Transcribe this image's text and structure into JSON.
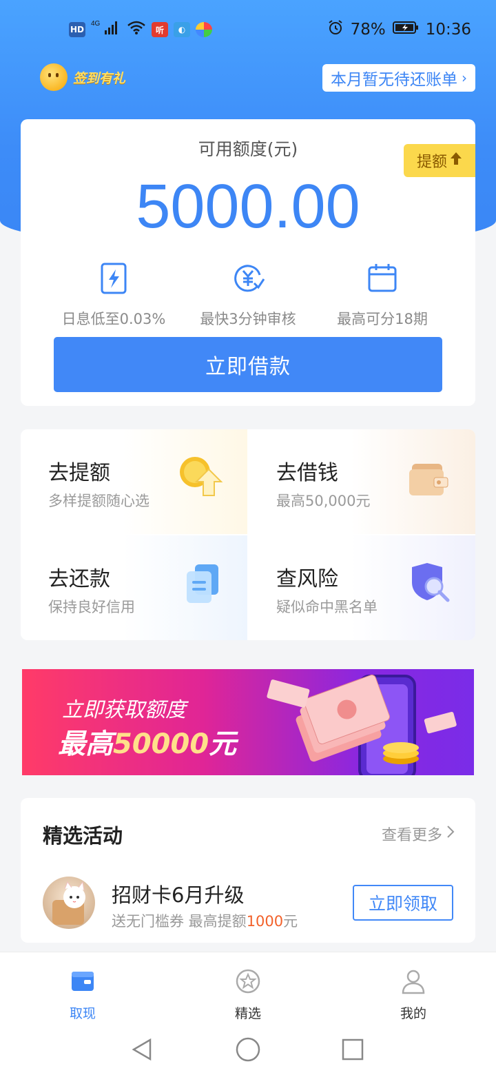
{
  "status_bar": {
    "network": "4G",
    "hd_label": "HD",
    "ting_label": "听",
    "battery": "78%",
    "time": "10:36"
  },
  "header": {
    "checkin_label": "签到有礼",
    "bill_status": "本月暂无待还账单"
  },
  "credit": {
    "title": "可用额度(元)",
    "amount": "5000.00",
    "boost_label": "提额",
    "features": [
      {
        "icon": "lightning-icon",
        "label": "日息低至0.03%"
      },
      {
        "icon": "yuan-review-icon",
        "label": "最快3分钟审核"
      },
      {
        "icon": "calendar-icon",
        "label": "最高可分18期"
      }
    ],
    "borrow_button": "立即借款"
  },
  "services": [
    {
      "title": "去提额",
      "subtitle": "多样提额随心选",
      "icon": "coin-up-icon"
    },
    {
      "title": "去借钱",
      "subtitle": "最高50,000元",
      "icon": "wallet-icon"
    },
    {
      "title": "去还款",
      "subtitle": "保持良好信用",
      "icon": "document-icon"
    },
    {
      "title": "查风险",
      "subtitle": "疑似命中黑名单",
      "icon": "shield-search-icon"
    }
  ],
  "banner": {
    "line1": "立即获取额度",
    "line2_prefix": "最高",
    "line2_amount": "50000",
    "line2_suffix": "元"
  },
  "activities": {
    "title": "精选活动",
    "more": "查看更多",
    "item": {
      "name": "招财卡6月升级",
      "desc_prefix": "送无门槛券  最高提额",
      "desc_highlight": "1000",
      "desc_suffix": "元",
      "button": "立即领取"
    }
  },
  "tabbar": [
    {
      "label": "取现",
      "icon": "wallet-tab-icon",
      "active": true
    },
    {
      "label": "精选",
      "icon": "star-circle-icon",
      "active": false
    },
    {
      "label": "我的",
      "icon": "person-icon",
      "active": false
    }
  ],
  "colors": {
    "primary": "#4188f7",
    "accent_gold": "#fbd84c",
    "highlight": "#f2612a"
  }
}
